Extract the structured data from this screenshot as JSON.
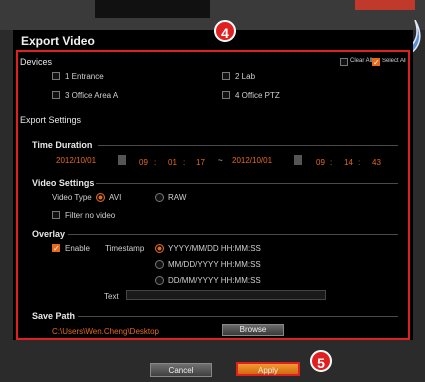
{
  "window": {
    "title": "Export Video"
  },
  "badges": {
    "step4": "4",
    "step5": "5"
  },
  "devices": {
    "label": "Devices",
    "clear_all": "Clear All",
    "select_all": "Select All",
    "items": [
      "1 Entrance",
      "2 Lab",
      "3 Office Area A",
      "4 Office PTZ"
    ]
  },
  "export_settings": {
    "label": "Export Settings"
  },
  "time_duration": {
    "label": "Time Duration",
    "start_date": "2012/10/01",
    "start_h": "09",
    "start_m": "01",
    "start_s": "17",
    "separator": "~",
    "end_date": "2012/10/01",
    "end_h": "09",
    "end_m": "14",
    "end_s": "43",
    "colon": ":"
  },
  "video_settings": {
    "label": "Video Settings",
    "video_type_label": "Video Type",
    "avi": "AVI",
    "raw": "RAW",
    "filter": "Filter no video"
  },
  "overlay": {
    "label": "Overlay",
    "enable": "Enable",
    "timestamp_label": "Timestamp",
    "formats": [
      "YYYY/MM/DD HH:MM:SS",
      "MM/DD/YYYY HH:MM:SS",
      "DD/MM/YYYY HH:MM:SS"
    ],
    "text_label": "Text"
  },
  "save_path": {
    "label": "Save Path",
    "path": "C:\\Users\\Wen.Cheng\\Desktop",
    "browse": "Browse"
  },
  "footer": {
    "cancel": "Cancel",
    "apply": "Apply"
  },
  "colors": {
    "accent": "#e8691c",
    "highlight": "#e02020"
  }
}
